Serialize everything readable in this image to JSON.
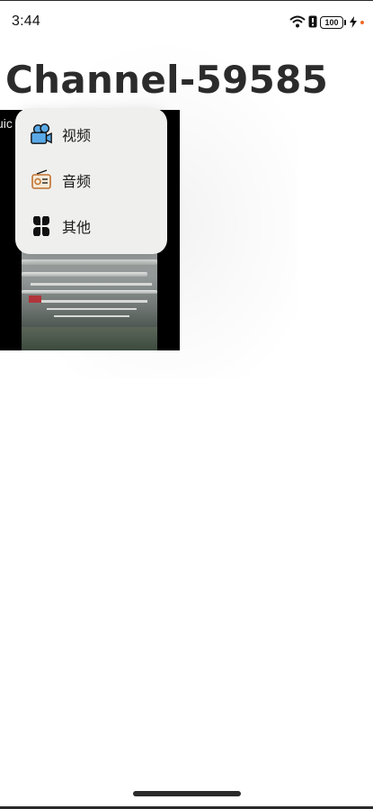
{
  "status_bar": {
    "time": "3:44",
    "battery_level": "100",
    "icons": [
      "wifi-icon",
      "alert-icon",
      "battery-icon",
      "charging-icon"
    ]
  },
  "page": {
    "title": "Channel-59585"
  },
  "video": {
    "caption": "uic"
  },
  "popup_menu": {
    "items": [
      {
        "label": "视频",
        "icon": "video-camera-icon"
      },
      {
        "label": "音频",
        "icon": "radio-icon"
      },
      {
        "label": "其他",
        "icon": "grid-icon"
      }
    ]
  },
  "colors": {
    "accent_blue": "#5aa9e6",
    "radio_orange": "#c0712f",
    "charge_dot": "#f06a2a"
  }
}
